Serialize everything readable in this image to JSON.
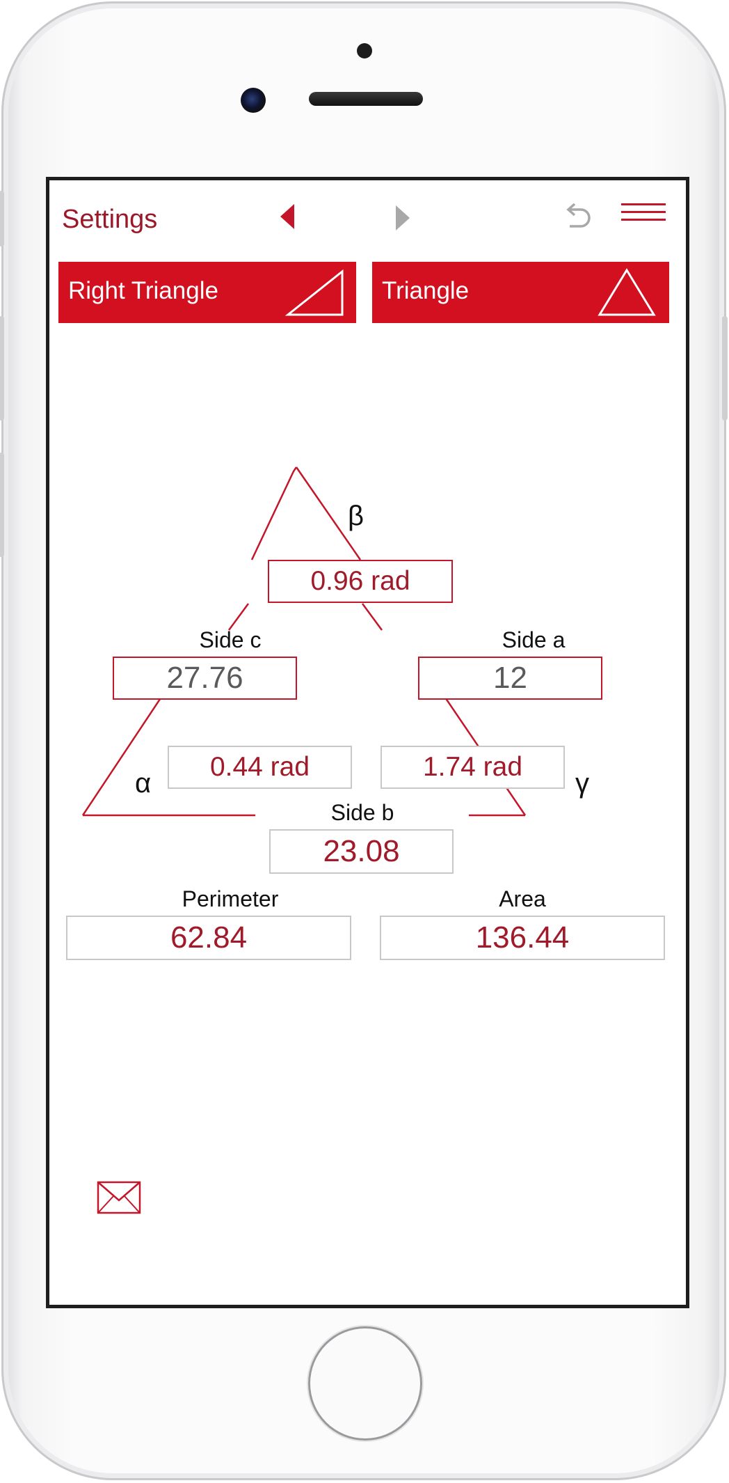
{
  "nav": {
    "title": "Settings",
    "icons": [
      "back-arrow-icon",
      "forward-arrow-icon",
      "undo-icon",
      "menu-icon"
    ],
    "accent_color": "#c4162a",
    "inactive_color": "#a8a8a8"
  },
  "tabs": [
    {
      "label": "Right Triangle",
      "icon": "right-triangle-icon"
    },
    {
      "label": "Triangle",
      "icon": "triangle-icon"
    }
  ],
  "triangle": {
    "beta_symbol": "β",
    "alpha_symbol": "α",
    "gamma_symbol": "γ",
    "beta_value": "0.96 rad",
    "alpha_value": "0.44 rad",
    "gamma_value": "1.74 rad",
    "side_c_label": "Side c",
    "side_c_value": "27.76",
    "side_a_label": "Side a",
    "side_a_value": "12",
    "side_b_label": "Side b",
    "side_b_value": "23.08"
  },
  "results": {
    "perimeter_label": "Perimeter",
    "perimeter_value": "62.84",
    "area_label": "Area",
    "area_value": "136.44"
  },
  "footer": {
    "icon": "mail-icon"
  }
}
